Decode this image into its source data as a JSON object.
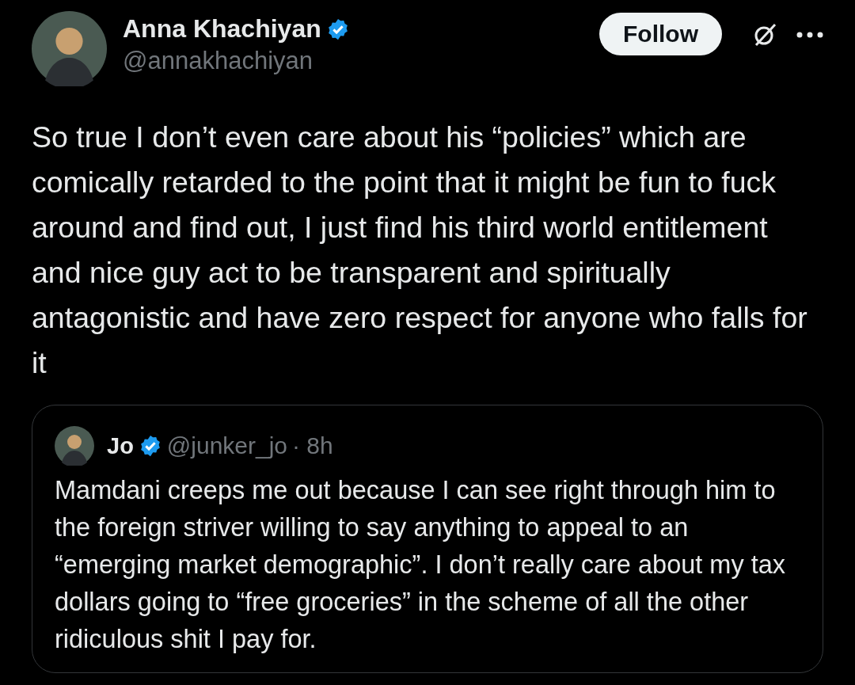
{
  "author": {
    "name": "Anna Khachiyan",
    "verified": true,
    "handle": "@annakhachiyan"
  },
  "follow_button": {
    "label": "Follow"
  },
  "text": "So true I don’t even care about his “policies” which are comically retarded to the point that it might be fun to fuck around and find out, I just find his third world entitlement and nice guy act to be transparent and spiritually antagonistic and have zero respect for anyone who falls for it",
  "quoted_post": {
    "name": "Jo",
    "verified": true,
    "handle": "@junker_jo",
    "time": "· 8h",
    "text": "Mamdani creeps me out because I can see right through him to the foreign striver willing to say anything to appeal to an “emerging market demographic”. I don’t really care about my tax dollars going to “free groceries” in the scheme of all the other ridiculous shit I pay for."
  }
}
